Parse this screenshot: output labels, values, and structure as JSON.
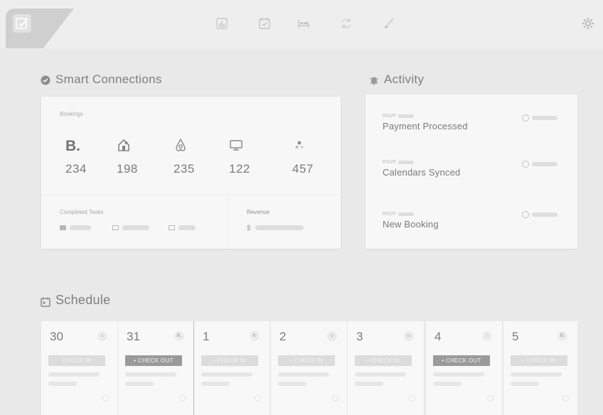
{
  "topnav": {
    "icons": [
      "dashboard-icon",
      "calendar-check-icon",
      "bed-icon",
      "sync-icon",
      "brush-icon"
    ],
    "settings_icon": "gear-icon"
  },
  "smart_connections": {
    "title": "Smart Connections",
    "bookings_label": "Bookings",
    "platforms": [
      {
        "icon": "booking-b",
        "glyph": "B.",
        "count": "234"
      },
      {
        "icon": "homeaway-house-icon",
        "count": "198"
      },
      {
        "icon": "airbnb-icon",
        "count": "235"
      },
      {
        "icon": "desktop-icon",
        "count": "122"
      },
      {
        "icon": "group-dots-icon",
        "count": "457"
      }
    ],
    "completed_tasks_label": "Completed Tasks",
    "revenue_label": "Revenue",
    "revenue_currency": "$"
  },
  "activity": {
    "title": "Activity",
    "items": [
      {
        "tag": "RSVP",
        "title": "Payment Processed"
      },
      {
        "tag": "RSVP",
        "title": "Calendars Synced"
      },
      {
        "tag": "RSVP",
        "title": "New Booking"
      }
    ]
  },
  "schedule": {
    "title": "Schedule",
    "days": [
      {
        "day": "30",
        "badge": "",
        "status": "CHECK IN",
        "kind": "in"
      },
      {
        "day": "31",
        "badge": "B.",
        "status": "• CHECK OUT",
        "kind": "out"
      },
      {
        "day": "1",
        "badge": "",
        "status": "• CHECK IN",
        "kind": "in"
      },
      {
        "day": "2",
        "badge": "",
        "status": "• CHECK IN",
        "kind": "in"
      },
      {
        "day": "3",
        "badge": "",
        "status": "• CHECK IN",
        "kind": "in"
      },
      {
        "day": "4",
        "badge": "",
        "status": "• CHECK OUT",
        "kind": "out"
      },
      {
        "day": "5",
        "badge": "B.",
        "status": "• CHECK IN",
        "kind": "in"
      }
    ]
  }
}
